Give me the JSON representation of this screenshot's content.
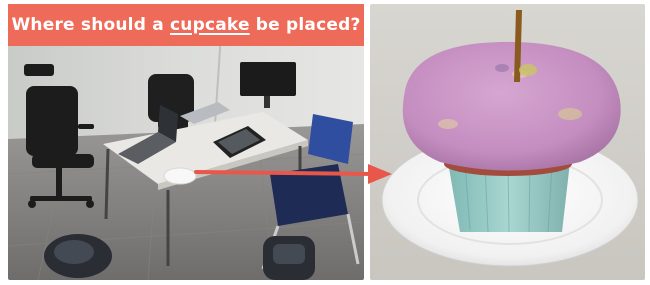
{
  "question": {
    "prefix": "Where should a ",
    "keyword": "cupcake",
    "suffix": " be placed?"
  },
  "colors": {
    "banner": "#ee6a59",
    "arrow": "#e8574a",
    "banner_text": "#ffffff"
  },
  "panels": {
    "left": "office-room-photo",
    "right": "cupcake-on-plate-render"
  }
}
